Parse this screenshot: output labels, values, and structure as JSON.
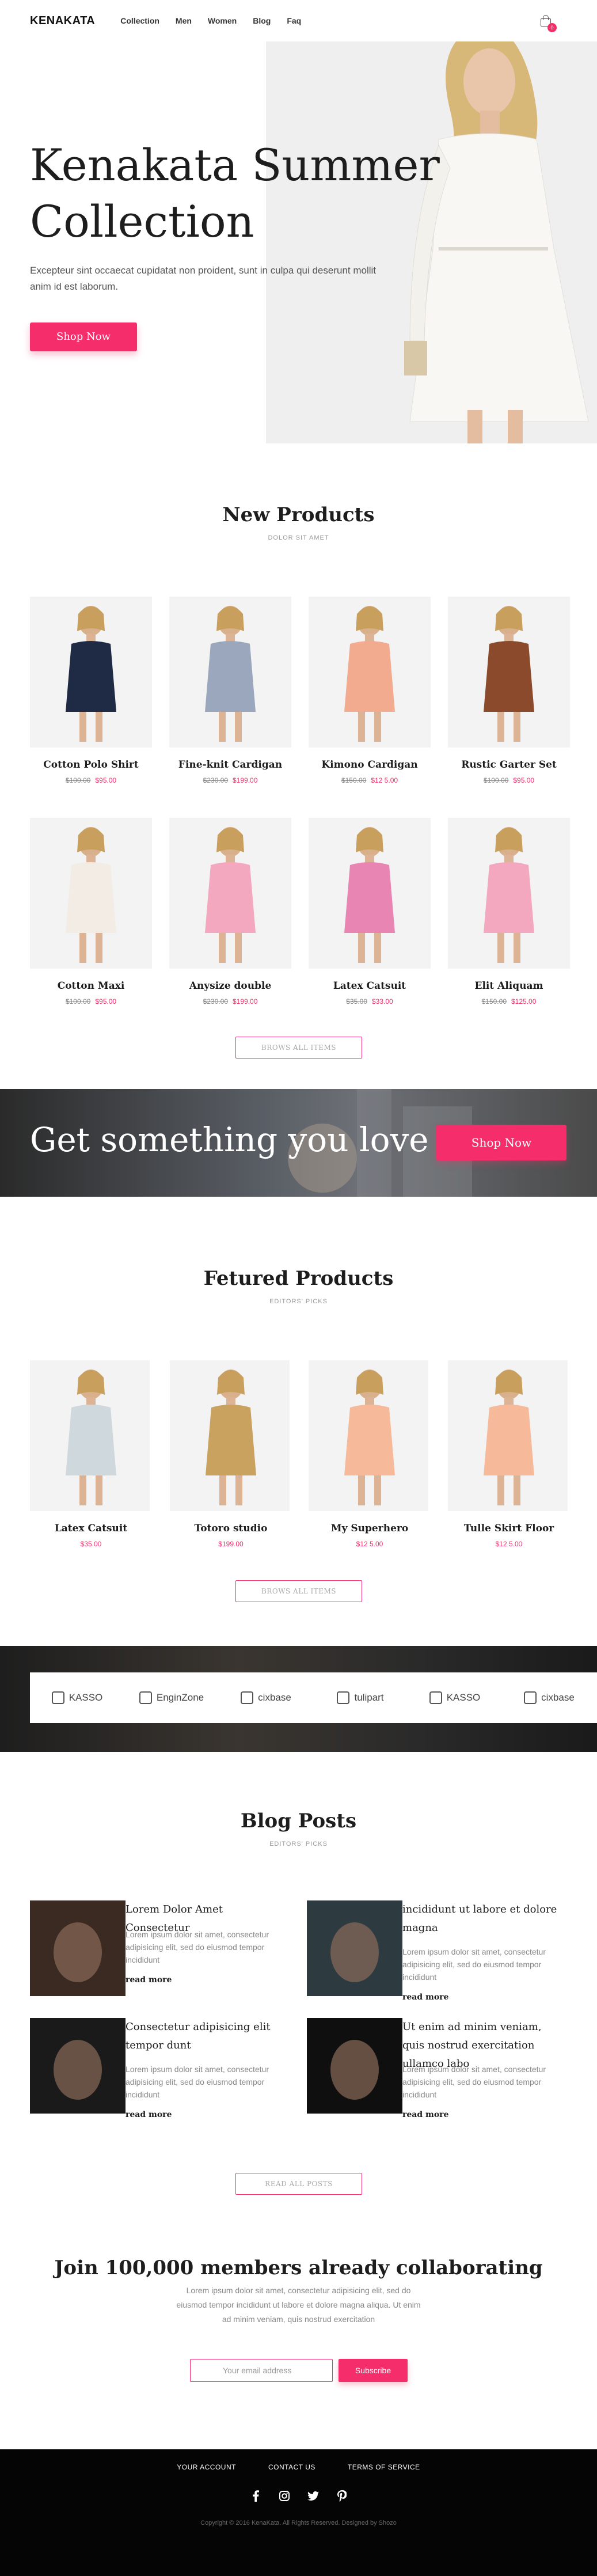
{
  "header": {
    "logo": "KENAKATA",
    "nav": [
      "Collection",
      "Men",
      "Women",
      "Blog",
      "Faq"
    ],
    "cart_count": "0",
    "cart_icon": "shopping-bag-icon"
  },
  "hero": {
    "title": "Kenakata Summer Collection",
    "subtitle": "Excepteur sint occaecat cupidatat non proident, sunt in culpa qui deserunt mollit anim id est laborum.",
    "cta": "Shop Now"
  },
  "new_products": {
    "title": "New Products",
    "subtitle": "DOLOR SIT AMET",
    "items": [
      {
        "name": "Cotton Polo Shirt",
        "old": "$100.00",
        "price": "$95.00",
        "color": "#1f2a44"
      },
      {
        "name": "Fine-knit Cardigan",
        "old": "$230.00",
        "price": "$199.00",
        "color": "#9aa7bd"
      },
      {
        "name": "Kimono Cardigan",
        "old": "$150.00",
        "price": "$12 5.00",
        "color": "#f2ab8e"
      },
      {
        "name": "Rustic Garter Set",
        "old": "$100.00",
        "price": "$95.00",
        "color": "#8b4a2b"
      },
      {
        "name": "Cotton Maxi",
        "old": "$100.00",
        "price": "$95.00",
        "color": "#f2ece4"
      },
      {
        "name": "Anysize double",
        "old": "$230.00",
        "price": "$199.00",
        "color": "#f3a8c0"
      },
      {
        "name": "Latex Catsuit",
        "old": "$35.00",
        "price": "$33.00",
        "color": "#e985b2"
      },
      {
        "name": "Elit Aliquam",
        "old": "$150.00",
        "price": "$125.00",
        "color": "#f3a8c0"
      }
    ],
    "browse": "BROWS ALL ITEMS"
  },
  "banner": {
    "text": "Get something you love",
    "cta": "Shop Now"
  },
  "featured": {
    "title": "Fetured Products",
    "subtitle": "EDITORS' PICKS",
    "items": [
      {
        "name": "Latex Catsuit",
        "price": "$35.00",
        "color": "#cfd8dc"
      },
      {
        "name": "Totoro studio",
        "price": "$199.00",
        "color": "#c8a25e"
      },
      {
        "name": "My Superhero",
        "price": "$12 5.00",
        "color": "#f6b99a"
      },
      {
        "name": "Tulle Skirt Floor",
        "price": "$12 5.00",
        "color": "#f6b99a"
      }
    ],
    "browse": "BROWS ALL ITEMS"
  },
  "brands": [
    {
      "name": "KASSO",
      "icon": "kasso-logo-icon"
    },
    {
      "name": "EnginZone",
      "icon": "enginzone-logo-icon"
    },
    {
      "name": "cixbase",
      "icon": "cixbase-logo-icon"
    },
    {
      "name": "tulipart",
      "icon": "tulipart-logo-icon"
    },
    {
      "name": "KASSO",
      "icon": "kasso-logo-icon"
    },
    {
      "name": "cixbase",
      "icon": "cixbase-logo-icon"
    }
  ],
  "blog": {
    "title": "Blog Posts",
    "subtitle": "EDITORS' PICKS",
    "posts": [
      {
        "title": "Lorem Dolor Amet Consectetur",
        "text": "Lorem ipsum dolor sit amet, consectetur adipisicing elit, sed do eiusmod tempor incididunt",
        "more": "read more"
      },
      {
        "title": "incididunt ut labore et dolore magna",
        "text": "Lorem ipsum dolor sit amet, consectetur adipisicing elit, sed do eiusmod tempor incididunt",
        "more": "read more"
      },
      {
        "title": "Consectetur adipisicing elit tempor dunt",
        "text": "Lorem ipsum dolor sit amet, consectetur adipisicing elit, sed do eiusmod tempor incididunt",
        "more": "read more"
      },
      {
        "title": "Ut enim ad minim veniam, quis nostrud exercitation ullamco labo",
        "text": "Lorem ipsum dolor sit amet, consectetur adipisicing elit, sed do eiusmod tempor incididunt",
        "more": "read more"
      }
    ],
    "read_all": "READ ALL POSTS"
  },
  "newsletter": {
    "title": "Join 100,000 members already collaborating",
    "text": "Lorem ipsum dolor sit amet, consectetur adipisicing elit, sed do eiusmod tempor incididunt ut labore et dolore magna aliqua. Ut enim ad minim veniam, quis nostrud exercitation",
    "placeholder": "Your email address",
    "button": "Subscribe"
  },
  "footer": {
    "links": [
      "YOUR ACCOUNT",
      "CONTACT US",
      "TERMS OF SERVICE"
    ],
    "social": [
      "facebook-icon",
      "instagram-icon",
      "twitter-icon",
      "pinterest-icon"
    ],
    "copyright": "Copyright © 2016 KenaKata. All Rights Reserved. Designed by Shozo"
  },
  "colors": {
    "accent": "#f52e6b",
    "dark": "#1d1d1d",
    "footer": "#050505"
  }
}
